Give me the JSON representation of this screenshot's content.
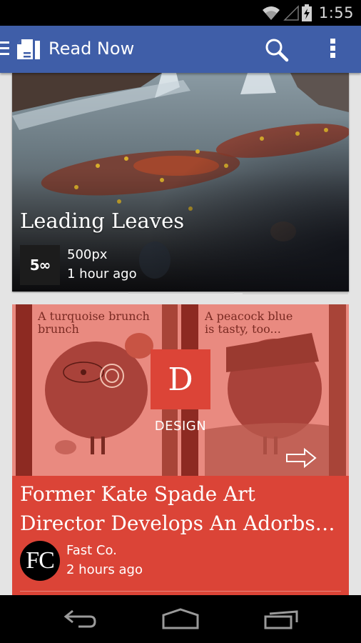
{
  "status_bar": {
    "time": "1:55",
    "icons": [
      "wifi-icon",
      "cell-signal-icon",
      "battery-charging-icon"
    ]
  },
  "app_bar": {
    "title": "Read Now",
    "icons": [
      "menu-icon",
      "newsstand-logo-icon",
      "search-icon",
      "overflow-menu-icon"
    ]
  },
  "feed": {
    "cards": [
      {
        "title": "Leading Leaves",
        "source": "500px",
        "source_logo_text": "5∞",
        "time": "1 hour ago",
        "image": "waterfall with autumn leaves"
      },
      {
        "title": "Former Kate Spade Art Director Develops An Adorbs…",
        "source": "Fast Co.",
        "source_logo_text": "FC",
        "time": "2 hours ago",
        "category_badge_letter": "D",
        "category": "DESIGN",
        "image_captions": [
          "A turquoise brunch",
          "A peacock blue is tasty, too..."
        ],
        "accent_color": "#db4437"
      }
    ]
  },
  "colors": {
    "app_bar": "#3f5ea8",
    "design_accent": "#db4437",
    "background": "#e4e4e4"
  },
  "nav_bar": {
    "buttons": [
      "back-button",
      "home-button",
      "recents-button"
    ]
  }
}
